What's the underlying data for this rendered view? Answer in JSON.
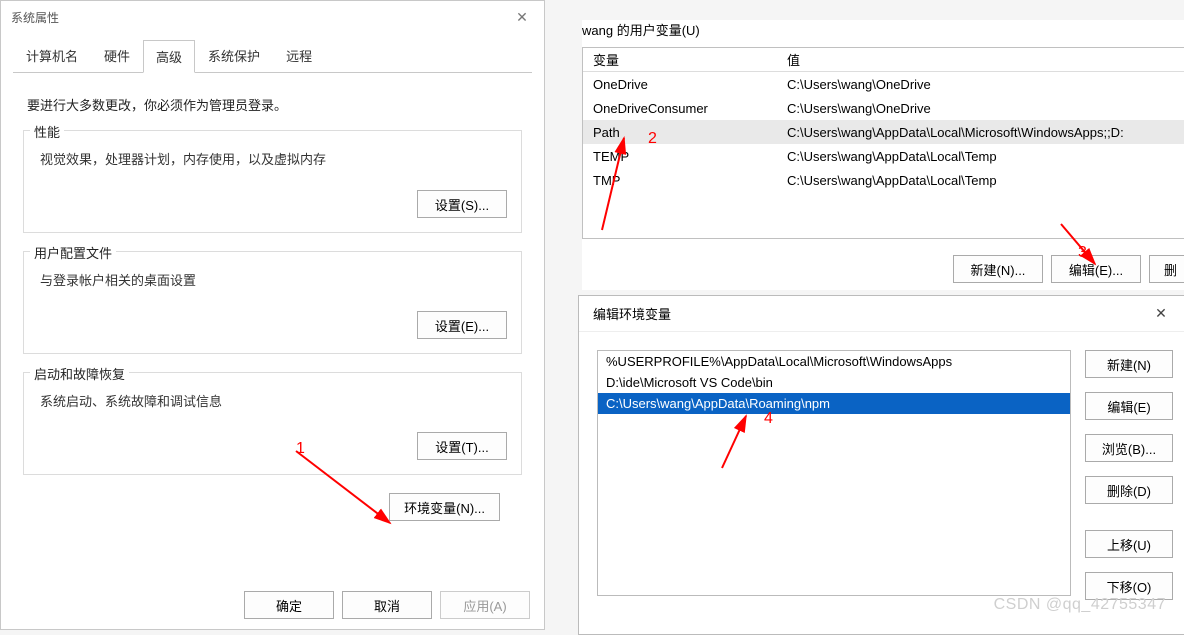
{
  "sysprops": {
    "title": "系统属性",
    "tabs": [
      "计算机名",
      "硬件",
      "高级",
      "系统保护",
      "远程"
    ],
    "active_tab": 2,
    "intro": "要进行大多数更改，你必须作为管理员登录。",
    "perf": {
      "title": "性能",
      "desc": "视觉效果，处理器计划，内存使用，以及虚拟内存",
      "button": "设置(S)..."
    },
    "profiles": {
      "title": "用户配置文件",
      "desc": "与登录帐户相关的桌面设置",
      "button": "设置(E)..."
    },
    "startup": {
      "title": "启动和故障恢复",
      "desc": "系统启动、系统故障和调试信息",
      "button": "设置(T)..."
    },
    "env_button": "环境变量(N)...",
    "footer": {
      "ok": "确定",
      "cancel": "取消",
      "apply": "应用(A)"
    }
  },
  "uservars": {
    "caption": "wang 的用户变量(U)",
    "headers": {
      "var": "变量",
      "val": "值"
    },
    "rows": [
      {
        "var": "OneDrive",
        "val": "C:\\Users\\wang\\OneDrive"
      },
      {
        "var": "OneDriveConsumer",
        "val": "C:\\Users\\wang\\OneDrive"
      },
      {
        "var": "Path",
        "val": "C:\\Users\\wang\\AppData\\Local\\Microsoft\\WindowsApps;;D:"
      },
      {
        "var": "TEMP",
        "val": "C:\\Users\\wang\\AppData\\Local\\Temp"
      },
      {
        "var": "TMP",
        "val": "C:\\Users\\wang\\AppData\\Local\\Temp"
      }
    ],
    "selected": 2,
    "buttons": {
      "new": "新建(N)...",
      "edit": "编辑(E)...",
      "del": "删"
    }
  },
  "editdlg": {
    "title": "编辑环境变量",
    "items": [
      "%USERPROFILE%\\AppData\\Local\\Microsoft\\WindowsApps",
      "D:\\ide\\Microsoft VS Code\\bin",
      "C:\\Users\\wang\\AppData\\Roaming\\npm"
    ],
    "selected": 2,
    "buttons": {
      "new": "新建(N)",
      "edit": "编辑(E)",
      "browse": "浏览(B)...",
      "del": "删除(D)",
      "up": "上移(U)",
      "down": "下移(O)"
    }
  },
  "annotations": {
    "n1": "1",
    "n2": "2",
    "n3": "3",
    "n4": "4"
  },
  "watermark": "CSDN @qq_42755347"
}
